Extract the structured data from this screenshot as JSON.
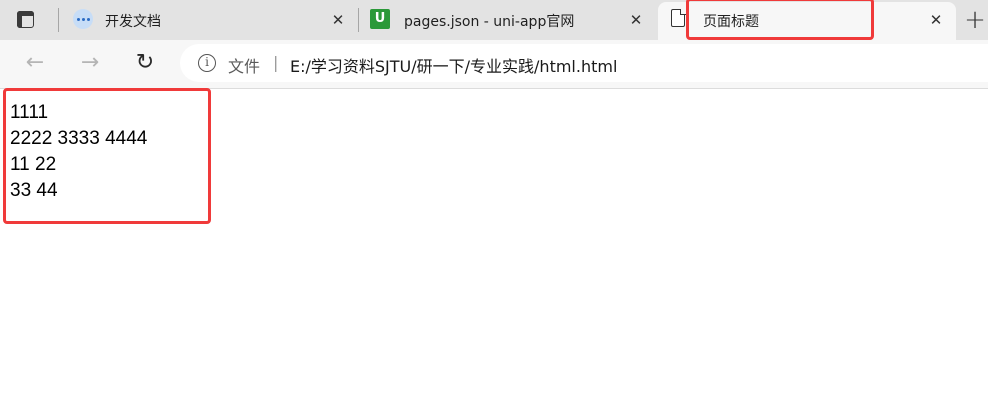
{
  "tabs": [
    {
      "title": "开发文档",
      "icon": "chat-bubble-icon",
      "active": false
    },
    {
      "title": "pages.json - uni-app官网",
      "icon": "uni-app-logo-icon",
      "active": false
    },
    {
      "title": "页面标题",
      "icon": "page-icon",
      "active": true
    }
  ],
  "tab_close_glyph": "✕",
  "new_tab_glyph": "+",
  "address": {
    "scheme_label": "文件",
    "divider": "|",
    "url": "E:/学习资料SJTU/研一下/专业实践/html.html"
  },
  "nav": {
    "back_glyph": "←",
    "forward_glyph": "→",
    "refresh_glyph": "↻"
  },
  "page": {
    "lines": [
      "1111",
      "2222 3333 4444",
      "11 22",
      "33 44"
    ]
  },
  "annotation_color": "#f03a3a"
}
